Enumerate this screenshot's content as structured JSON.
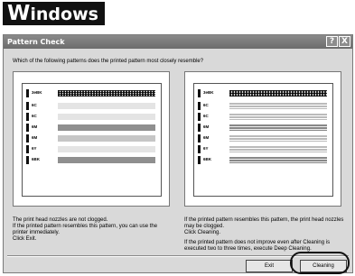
{
  "os_badge": {
    "first": "W",
    "rest": "indows"
  },
  "dialog": {
    "title": "Pattern Check",
    "help_btn": "?",
    "close_btn": "X",
    "question": "Which of the following patterns does the printed pattern most closely resemble?",
    "row_labels": [
      "3eBK",
      "6C",
      "6C",
      "6M",
      "6M",
      "6Y",
      "6BK"
    ],
    "left_text": {
      "line1": "The print head nozzles are not clogged.",
      "line2": "If the printed pattern resembles this pattern, you can use the printer immediately.",
      "line3": "Click Exit."
    },
    "right_text": {
      "line1": "If the printed pattern resembles this pattern, the print head nozzles may be clogged.",
      "line2": "Click Cleaning.",
      "line3": "If the printed pattern does not improve even after Cleaning is executed two to three times, execute Deep Cleaning."
    },
    "exit_button": "Exit",
    "cleaning_button": "Cleaning"
  }
}
